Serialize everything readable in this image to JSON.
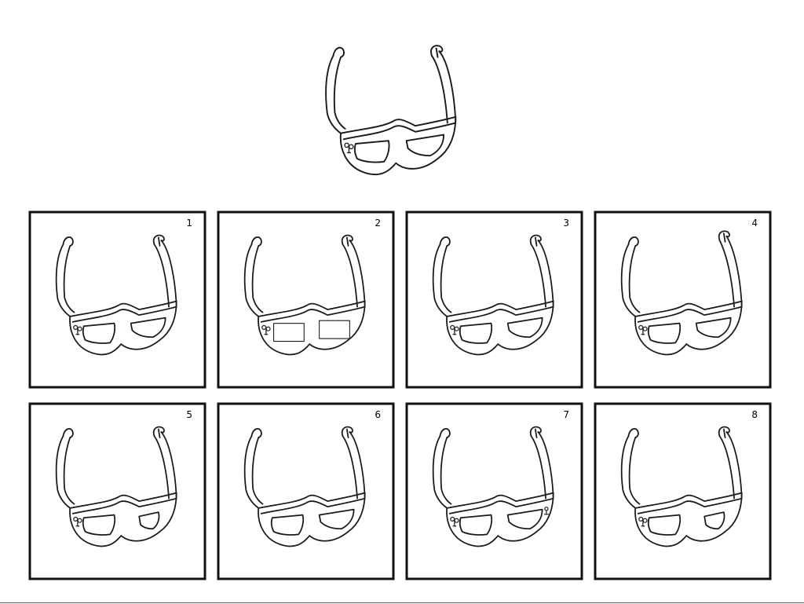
{
  "options": [
    {
      "label": "1"
    },
    {
      "label": "2"
    },
    {
      "label": "3"
    },
    {
      "label": "4"
    },
    {
      "label": "5"
    },
    {
      "label": "6"
    },
    {
      "label": "7"
    },
    {
      "label": "8"
    }
  ],
  "ink_color": "#1a1a1a",
  "frame_color": "#111111"
}
